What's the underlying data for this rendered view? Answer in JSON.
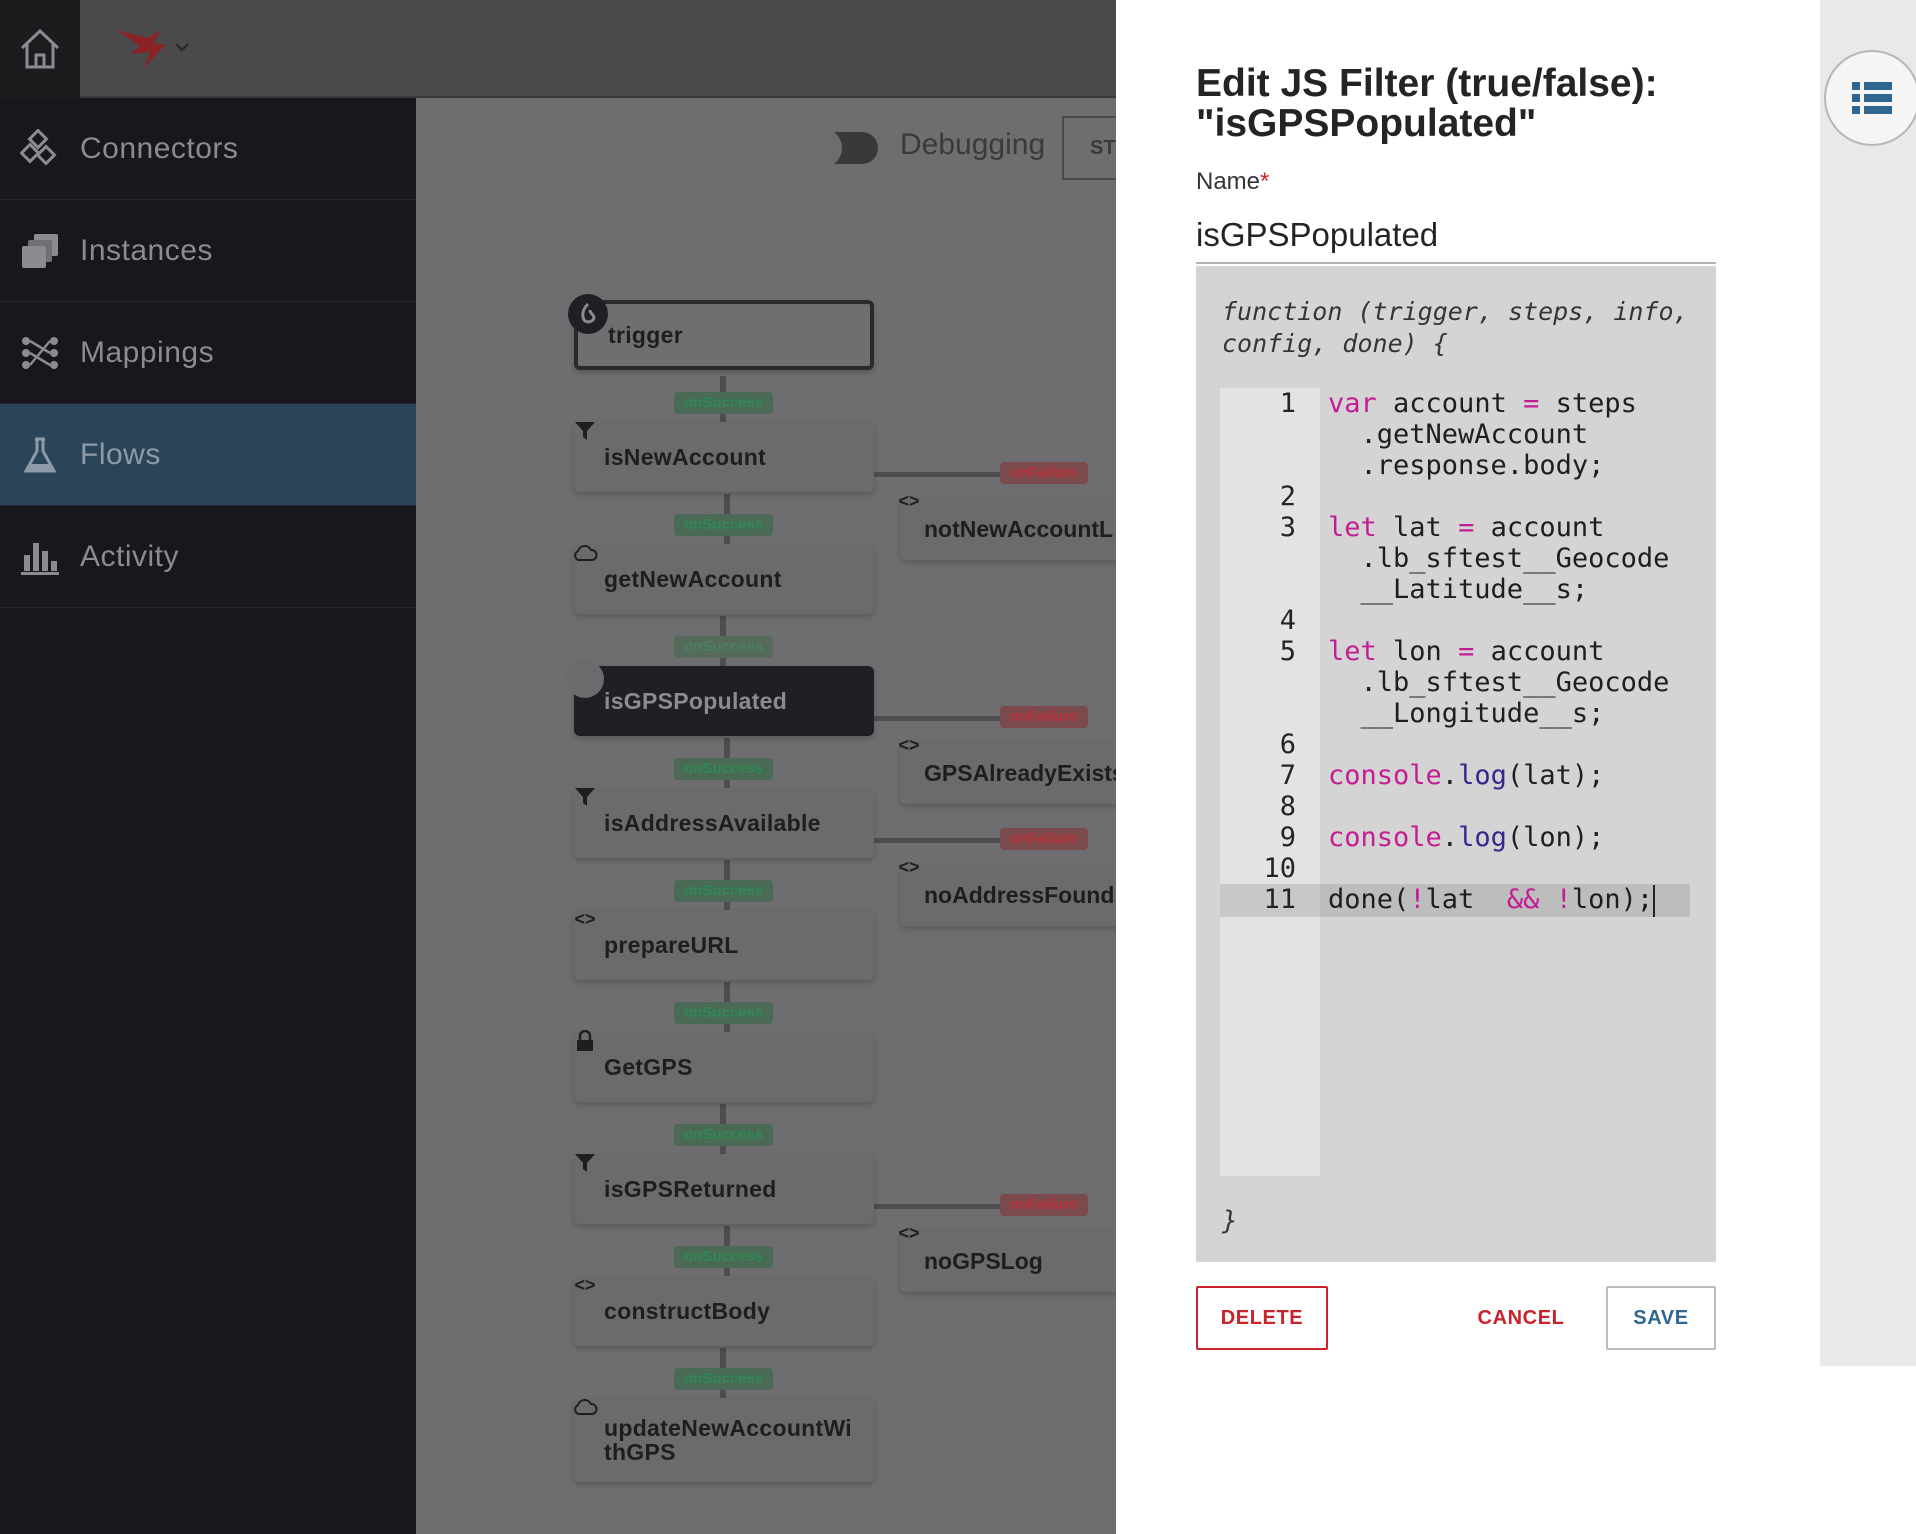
{
  "app": {
    "nav": [
      {
        "label": "Connectors",
        "icon": "connectors-icon",
        "active": false
      },
      {
        "label": "Instances",
        "icon": "instances-icon",
        "active": false
      },
      {
        "label": "Mappings",
        "icon": "mappings-icon",
        "active": false
      },
      {
        "label": "Flows",
        "icon": "flask-icon",
        "active": true
      },
      {
        "label": "Activity",
        "icon": "bar-chart-icon",
        "active": false
      }
    ],
    "debugging_label": "Debugging",
    "stop_button_label": "ST"
  },
  "flow": {
    "steps": [
      {
        "name": "trigger",
        "icon": "trigger-icon"
      },
      {
        "name": "isNewAccount",
        "icon": "filter-icon"
      },
      {
        "name": "getNewAccount",
        "icon": "cloud-icon"
      },
      {
        "name": "isGPSPopulated",
        "icon": "filter-icon",
        "selected": true
      },
      {
        "name": "isAddressAvailable",
        "icon": "filter-icon"
      },
      {
        "name": "prepareURL",
        "icon": "code-icon"
      },
      {
        "name": "GetGPS",
        "icon": "lock-icon"
      },
      {
        "name": "isGPSReturned",
        "icon": "filter-icon"
      },
      {
        "name": "constructBody",
        "icon": "code-icon"
      },
      {
        "name": "updateNewAccountWithGPS",
        "name_line1": "updateNewAccountWi",
        "name_line2": "thGPS",
        "icon": "cloud-icon"
      }
    ],
    "failure_steps": [
      {
        "name": "notNewAccountL",
        "icon": "code-icon"
      },
      {
        "name": "GPSAlreadyExists",
        "icon": "code-icon"
      },
      {
        "name": "noAddressFound",
        "icon": "code-icon"
      },
      {
        "name": "noGPSLog",
        "icon": "code-icon"
      }
    ],
    "success_label": "onSuccess",
    "failure_label": "onFailure"
  },
  "modal": {
    "title": "Edit JS Filter (true/false): \"isGPSPopulated\"",
    "name_label": "Name",
    "required_mark": "*",
    "name_value": "isGPSPopulated",
    "function_signature": "function (trigger, steps, info, config, done) {",
    "function_close": "}",
    "code_lines": [
      {
        "num": "1",
        "text": "var account = steps"
      },
      {
        "num": "",
        "text": "  .getNewAccount"
      },
      {
        "num": "",
        "text": "  .response.body;"
      },
      {
        "num": "2",
        "text": ""
      },
      {
        "num": "3",
        "text": "let lat = account"
      },
      {
        "num": "",
        "text": "  .lb_sftest__Geocode"
      },
      {
        "num": "",
        "text": "  __Latitude__s;"
      },
      {
        "num": "4",
        "text": ""
      },
      {
        "num": "5",
        "text": "let lon = account"
      },
      {
        "num": "",
        "text": "  .lb_sftest__Geocode"
      },
      {
        "num": "",
        "text": "  __Longitude__s;"
      },
      {
        "num": "6",
        "text": ""
      },
      {
        "num": "7",
        "text": "console.log(lat);"
      },
      {
        "num": "8",
        "text": ""
      },
      {
        "num": "9",
        "text": "console.log(lon);"
      },
      {
        "num": "10",
        "text": ""
      },
      {
        "num": "11",
        "text": "done(!lat  && !lon);"
      }
    ],
    "delete_label": "DELETE",
    "cancel_label": "CANCEL",
    "save_label": "SAVE"
  },
  "colors": {
    "accent_red": "#c8232b",
    "save_blue": "#2f6790",
    "keyword_magenta": "#c31c94",
    "method_purple": "#3b2490",
    "success_green": "#2e8a55",
    "nav_active": "#2a4559"
  }
}
